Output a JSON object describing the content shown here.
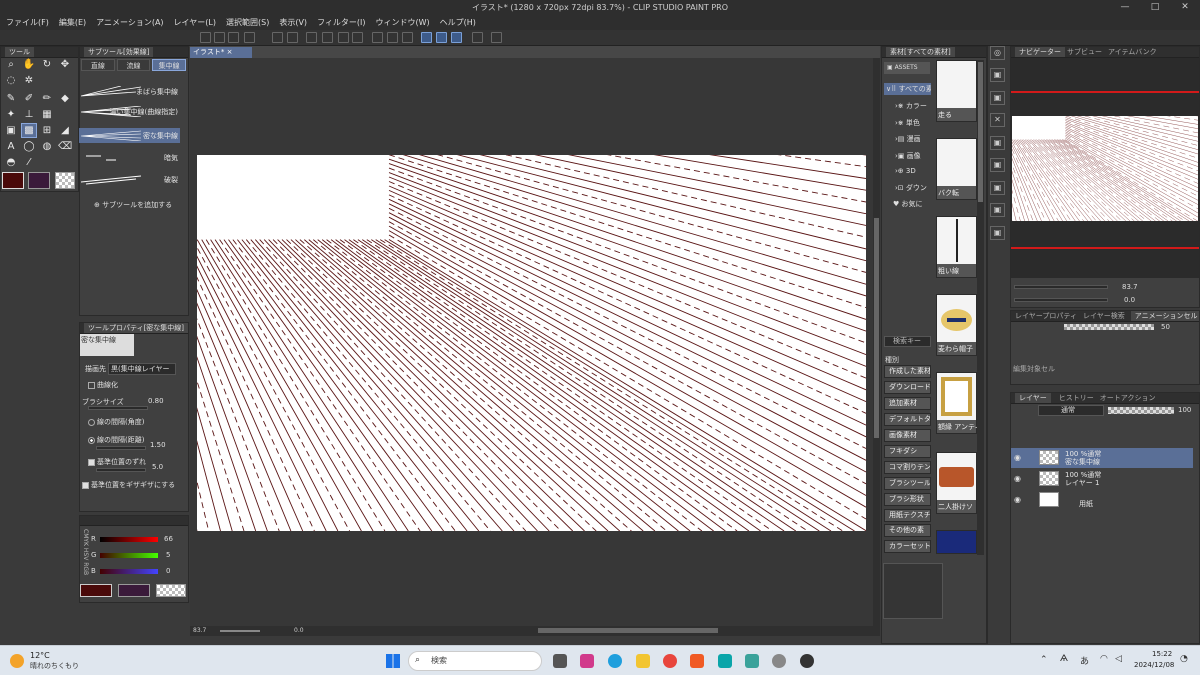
{
  "window": {
    "title": "イラスト* (1280 x 720px 72dpi 83.7%) - CLIP STUDIO PAINT PRO"
  },
  "menu": [
    "ファイル(F)",
    "編集(E)",
    "アニメーション(A)",
    "レイヤー(L)",
    "選択範囲(S)",
    "表示(V)",
    "フィルター(I)",
    "ウィンドウ(W)",
    "ヘルプ(H)"
  ],
  "panels": {
    "tool": {
      "tab": "ツール"
    },
    "subtool": {
      "tab": "サブツール[効果線]",
      "tabs": [
        "直線",
        "流線",
        "集中線"
      ],
      "items": [
        "まばら集中線",
        "濃い集中線(曲線指定)",
        "密な集中線",
        "暗気",
        "破裂"
      ],
      "add": "サブツールを追加する"
    },
    "toolprop": {
      "tab": "ツールプロパティ[密な集中線]",
      "preset": "密な集中線",
      "target_label": "描画先",
      "target_value": "黒(集中線レイヤー",
      "curve": "曲線化",
      "brush_size_label": "ブラシサイズ",
      "brush_size": "0.80",
      "interval_angle": "線の間隔(角度)",
      "interval_dist": "線の間隔(距離)",
      "interval_dist_value": "1.50",
      "offset_label": "基準位置のずれ",
      "offset_value": "5.0",
      "jagged": "基準位置をギザギザにする"
    },
    "color": {
      "r_label": "R",
      "r": "66",
      "g_label": "G",
      "g": "5",
      "b_label": "B",
      "b": "0",
      "modes": "CMYK HSV RGB",
      "main_color": "#4a0a0a",
      "sub_color": "#3a1a3a"
    },
    "canvas": {
      "tab": "イラスト*",
      "zoom": "83.7",
      "angle": "0.0"
    },
    "assets": {
      "tab": "素材[すべての素材]",
      "assets_label": "ASSETS",
      "root": "すべての素材",
      "categories": [
        "カラー",
        "単色",
        "漫画",
        "画像",
        "3D",
        "ダウン"
      ],
      "fav": "お気に",
      "search": "検索キー",
      "kind": "種別",
      "buttons": [
        "作成した素材",
        "ダウンロード",
        "追加素材",
        "デフォルトタ...",
        "画像素材",
        "フキダシ",
        "コマ割りテン",
        "ブラシツール",
        "ブラシ形状",
        "用紙テクスチ",
        "その他の素",
        "カラーセット"
      ],
      "thumbs": [
        "走る",
        "バク転",
        "粗い線",
        "麦わら帽子",
        "額縁 アンティ",
        "二人掛けソ",
        ""
      ]
    },
    "navigator": {
      "tab": "ナビゲーター",
      "tabs": [
        "サブビュー",
        "アイテムバンク"
      ],
      "zoom": "83.7",
      "angle": "0.0"
    },
    "layerprop": {
      "tabs": [
        "レイヤープロパティ",
        "レイヤー検索",
        "アニメーションセル"
      ],
      "opacity": "50",
      "hint": "編集対象セル"
    },
    "layers": {
      "tabs": [
        "レイヤー",
        "ヒストリー",
        "オートアクション"
      ],
      "blend": "通常",
      "opacity": "100",
      "list": [
        {
          "l1": "100 %通常",
          "l2": "密な集中線"
        },
        {
          "l1": "100 %通常",
          "l2": "レイヤー 1"
        },
        {
          "l1": "",
          "l2": "用紙"
        }
      ]
    }
  },
  "taskbar": {
    "temp": "12°C",
    "weather": "晴れのちくもり",
    "search": "検索",
    "time": "15:22",
    "date": "2024/12/08"
  },
  "colors": {
    "accent": "#5a6f97",
    "canvas_bg": "#ffffff",
    "line": "#5a1515"
  }
}
